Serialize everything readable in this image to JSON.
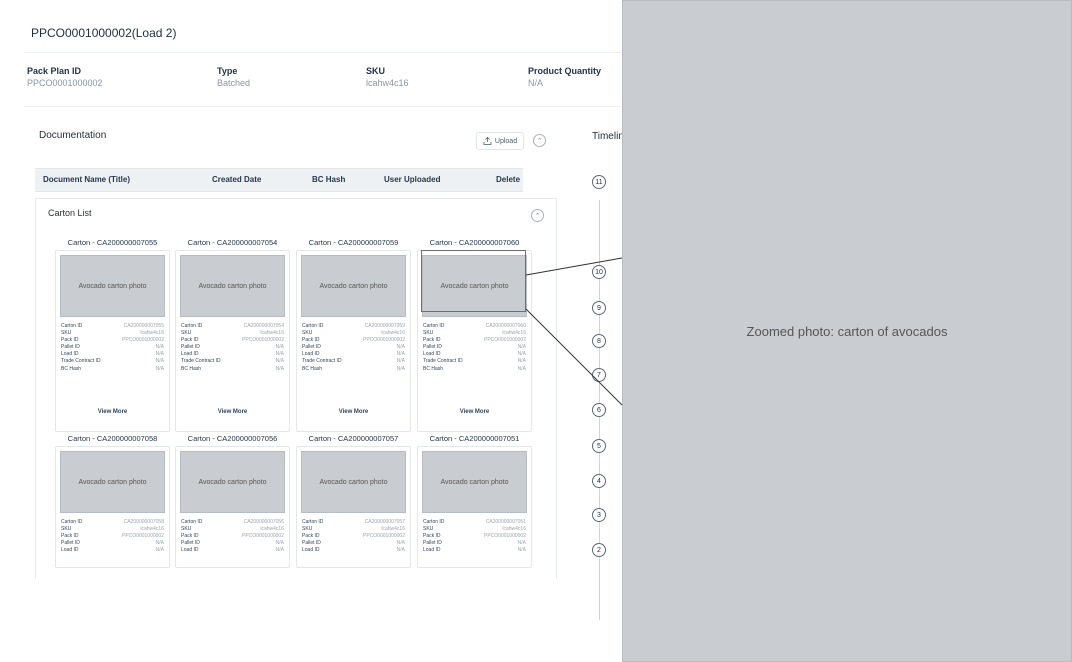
{
  "header": {
    "title": "PPCO0001000002(Load 2)"
  },
  "meta": [
    {
      "label": "Pack Plan ID",
      "value": "PPCO0001000002"
    },
    {
      "label": "Type",
      "value": "Batched"
    },
    {
      "label": "SKU",
      "value": "lcahw4c16"
    },
    {
      "label": "Product Quantity",
      "value": "N/A"
    }
  ],
  "documentation": {
    "title": "Documentation",
    "upload_label": "Upload",
    "columns": [
      "Document Name (Title)",
      "Created Date",
      "BC Hash",
      "User Uploaded",
      "Delete"
    ]
  },
  "timeline": {
    "title": "Timeline",
    "nodes": [
      "11",
      "10",
      "9",
      "8",
      "7",
      "6",
      "5",
      "4",
      "3",
      "2"
    ]
  },
  "carton_list": {
    "title": "Carton List",
    "view_more_label": "View More",
    "field_labels": [
      "Carton ID",
      "SKU",
      "Pack ID",
      "Pallet ID",
      "Load ID",
      "Trade Contract ID",
      "BC Hash"
    ],
    "cartons": [
      {
        "title": "Carton - CA200000007055",
        "photo_label": "Avocado carton photo",
        "values": [
          "CA200000007055",
          "lcahw4c16",
          "PPCO0001000002",
          "N/A",
          "N/A",
          "N/A",
          "N/A"
        ]
      },
      {
        "title": "Carton - CA200000007054",
        "photo_label": "Avocado carton photo",
        "values": [
          "CA200000007054",
          "lcahw4c16",
          "PPCO0001000002",
          "N/A",
          "N/A",
          "N/A",
          "N/A"
        ]
      },
      {
        "title": "Carton - CA200000007059",
        "photo_label": "Avocado carton photo",
        "values": [
          "CA200000007059",
          "lcahw4c16",
          "PPCO0001000002",
          "N/A",
          "N/A",
          "N/A",
          "N/A"
        ]
      },
      {
        "title": "Carton - CA200000007060",
        "photo_label": "Avocado carton photo",
        "values": [
          "CA200000007060",
          "lcahw4c16",
          "PPCO0001000002",
          "N/A",
          "N/A",
          "N/A",
          "N/A"
        ]
      },
      {
        "title": "Carton - CA200000007058",
        "photo_label": "Avocado carton photo",
        "values": [
          "CA200000007058",
          "lcahw4c16",
          "PPCO0001000002",
          "N/A",
          "N/A"
        ]
      },
      {
        "title": "Carton - CA200000007056",
        "photo_label": "Avocado carton photo",
        "values": [
          "CA200000007056",
          "lcahw4c16",
          "PPCO0001000002",
          "N/A",
          "N/A"
        ]
      },
      {
        "title": "Carton - CA200000007057",
        "photo_label": "Avocado carton photo",
        "values": [
          "CA200000007057",
          "lcahw4c16",
          "PPCO0001000002",
          "N/A",
          "N/A"
        ]
      },
      {
        "title": "Carton - CA200000007051",
        "photo_label": "Avocado carton photo",
        "values": [
          "CA200000007051",
          "lcahw4c16",
          "PPCO0001000002",
          "N/A",
          "N/A"
        ]
      }
    ]
  },
  "zoomed_photo": {
    "label": "Zoomed photo: carton of avocados"
  }
}
